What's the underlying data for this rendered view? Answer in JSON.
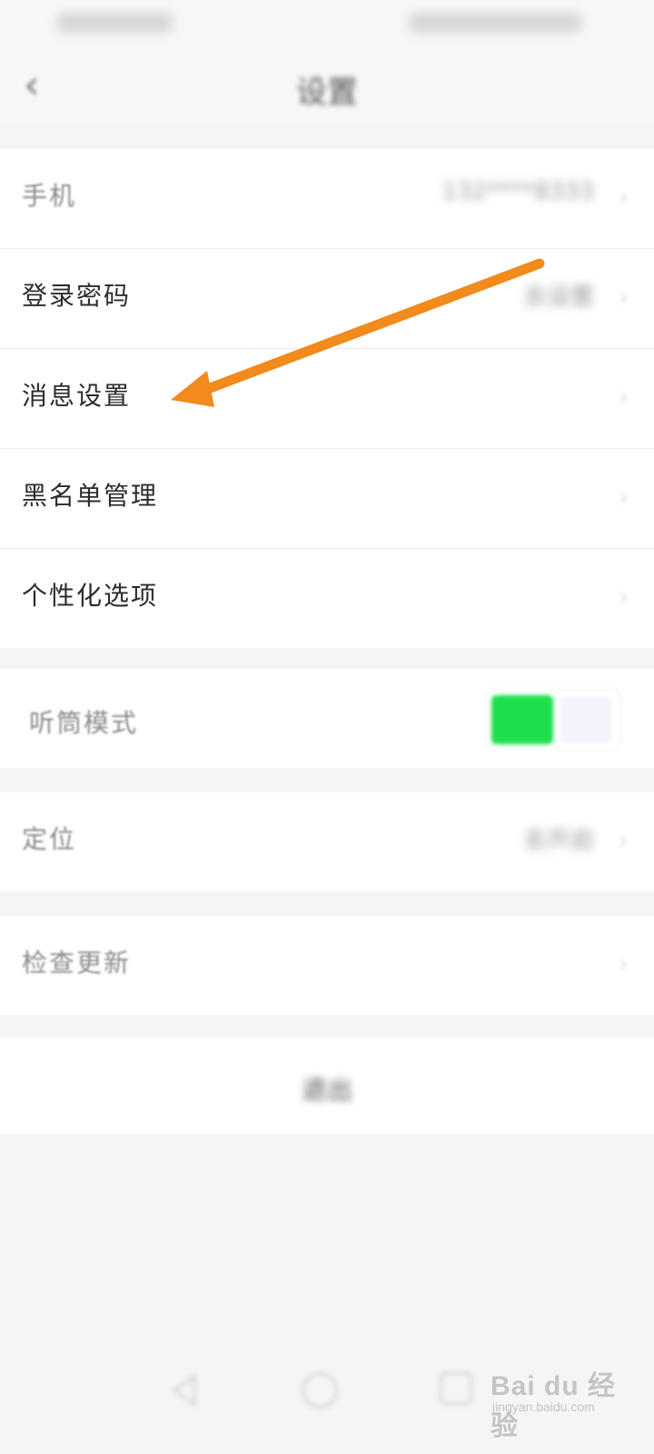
{
  "header": {
    "title": "设置",
    "back_icon": "‹"
  },
  "account_group": [
    {
      "label": "手机",
      "value": "132****8333",
      "blurred": true
    },
    {
      "label": "登录密码",
      "value": "去设置"
    },
    {
      "label": "消息设置"
    },
    {
      "label": "黑名单管理"
    },
    {
      "label": "个性化选项"
    }
  ],
  "earpiece": {
    "label": "听筒模式",
    "enabled": true
  },
  "misc_group": [
    {
      "label": "定位",
      "value": "去开启"
    },
    {
      "label": "检查更新"
    }
  ],
  "logout": {
    "label": "退出"
  },
  "colors": {
    "toggle_on": "#1fde4c",
    "arrow": "#f28a1c"
  },
  "watermark": {
    "brand": "Bai du 经验",
    "url": "jingyan.baidu.com"
  }
}
